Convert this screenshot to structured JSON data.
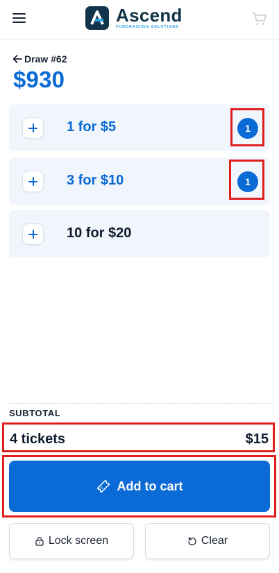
{
  "header": {
    "logo_word": "Ascend",
    "logo_subtitle": "FUNDRAISING SOLUTIONS",
    "menu_icon": "hamburger-menu-icon",
    "cart_icon": "shopping-cart-icon"
  },
  "draw": {
    "label": "Draw #62",
    "jackpot": "$930"
  },
  "options": [
    {
      "label": "1 for $5",
      "quantity": "1"
    },
    {
      "label": "3 for $10",
      "quantity": "1"
    },
    {
      "label": "10 for $20",
      "quantity": ""
    }
  ],
  "summary": {
    "subtotal_label": "SUBTOTAL",
    "tickets": "4 tickets",
    "amount": "$15"
  },
  "actions": {
    "add_to_cart": "Add to cart",
    "lock_screen": "Lock screen",
    "clear": "Clear"
  },
  "colors": {
    "primary": "#0a6ad6",
    "option_bg": "#f1f5fc",
    "highlight": "#e01e1e",
    "dark": "#0f1b2d"
  }
}
